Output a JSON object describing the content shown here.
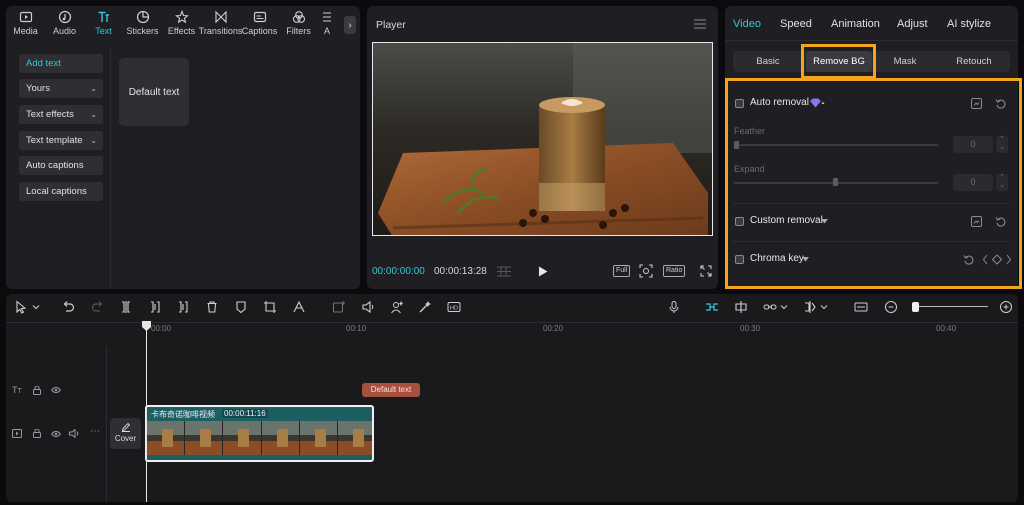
{
  "top_tabs": [
    {
      "label": "Media",
      "icon": "media-icon"
    },
    {
      "label": "Audio",
      "icon": "audio-icon"
    },
    {
      "label": "Text",
      "icon": "text-icon",
      "active": true
    },
    {
      "label": "Stickers",
      "icon": "stickers-icon"
    },
    {
      "label": "Effects",
      "icon": "effects-icon"
    },
    {
      "label": "Transitions",
      "icon": "transitions-icon"
    },
    {
      "label": "Captions",
      "icon": "captions-icon"
    },
    {
      "label": "Filters",
      "icon": "filters-icon"
    },
    {
      "label": "A",
      "icon": "adjust-icon"
    }
  ],
  "sidebar": {
    "items": [
      {
        "label": "Add text",
        "active": true
      },
      {
        "label": "Yours",
        "chevron": true
      },
      {
        "label": "Text effects",
        "chevron": true
      },
      {
        "label": "Text template",
        "chevron": true
      },
      {
        "label": "Auto captions"
      },
      {
        "label": "Local captions"
      }
    ]
  },
  "text_card": {
    "label": "Default text"
  },
  "player": {
    "title": "Player",
    "current_time": "00:00:00:00",
    "duration": "00:00:13:28",
    "full_label": "Full",
    "ratio_label": "Ratio"
  },
  "right_tabs": [
    {
      "label": "Video",
      "active": true
    },
    {
      "label": "Speed"
    },
    {
      "label": "Animation"
    },
    {
      "label": "Adjust"
    },
    {
      "label": "AI stylize"
    }
  ],
  "sub_tabs": [
    {
      "label": "Basic"
    },
    {
      "label": "Remove BG",
      "active": true
    },
    {
      "label": "Mask"
    },
    {
      "label": "Retouch"
    }
  ],
  "remove_bg": {
    "auto_removal": "Auto removal",
    "feather_label": "Feather",
    "feather_value": "0",
    "expand_label": "Expand",
    "expand_value": "0",
    "custom_removal": "Custom removal",
    "chroma_key": "Chroma key"
  },
  "timeline": {
    "ticks": [
      "00:00",
      "00:10",
      "00:20",
      "00:30",
      "00:40"
    ],
    "text_clip": "Default text",
    "video_clip_title": "卡布奇诺咖啡视频",
    "video_clip_time": "00:00:11:16",
    "cover_label": "Cover"
  },
  "colors": {
    "accent": "#35c6d3",
    "highlight": "#f4a51c",
    "text_clip": "#a8503f",
    "video_clip": "#1d5e62"
  }
}
